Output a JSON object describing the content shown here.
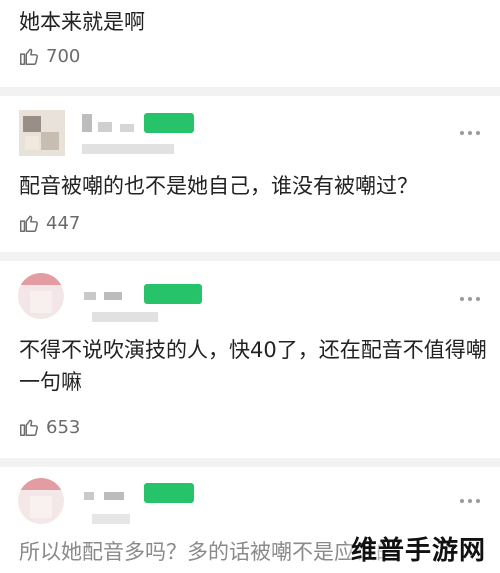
{
  "top_post": {
    "text": "她本来就是啊",
    "likes": "700"
  },
  "comments": [
    {
      "text": "配音被嘲的也不是她自己，谁没有被嘲过？",
      "likes": "447"
    },
    {
      "text": "不得不说吹演技的人，快40了，还在配音不值得嘲一句嘛",
      "likes": "653"
    },
    {
      "text": "所以她配音多吗？多的话被嘲不是应该的"
    }
  ],
  "watermark": "维普手游网",
  "colors": {
    "badge_green": "#27c36a",
    "divider": "#f2f2f2",
    "text": "#222222",
    "muted": "#6b6b6b"
  },
  "icons": {
    "like": "thumbs-up-icon",
    "more": "more-dots-icon"
  }
}
